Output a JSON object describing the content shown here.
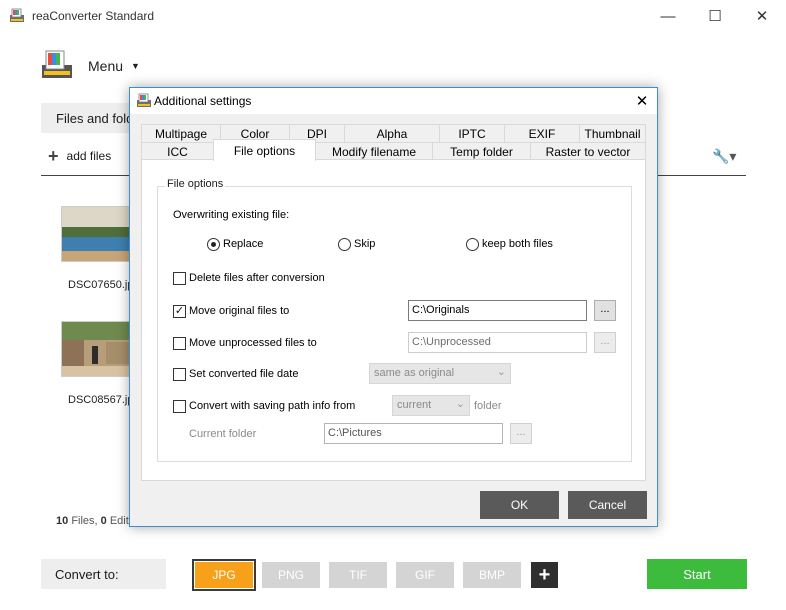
{
  "app": {
    "title": "reaConverter Standard",
    "controls": {
      "minimize": "—",
      "maximize": "☐",
      "close": "✕"
    },
    "menu_label": "Menu",
    "files_tab_label": "Files and folders",
    "add_files_label": "add files",
    "thumbnails": [
      {
        "name": "DSC07650.jpg"
      },
      {
        "name": "DSC08567.jpg"
      }
    ],
    "status": {
      "files_count": "10",
      "files_label": "Files,",
      "edit_count": "0",
      "edit_label": "Editing actions"
    },
    "convert_to_label": "Convert to:",
    "formats": [
      "JPG",
      "PNG",
      "TIF",
      "GIF",
      "BMP"
    ],
    "selected_format": "JPG",
    "add_format_label": "+",
    "start_label": "Start"
  },
  "dialog": {
    "title": "Additional settings",
    "close_label": "✕",
    "tabs_row1": [
      "Multipage",
      "Color",
      "DPI",
      "Alpha",
      "IPTC",
      "EXIF",
      "Thumbnail"
    ],
    "tabs_row2": [
      "ICC",
      "File options",
      "Modify filename",
      "Temp folder",
      "Raster to vector"
    ],
    "selected_tab": "File options",
    "group_title": "File options",
    "overwrite_label": "Overwriting existing file:",
    "overwrite_options": [
      "Replace",
      "Skip",
      "keep both files"
    ],
    "overwrite_selected": "Replace",
    "delete_label": "Delete files after conversion",
    "delete_checked": false,
    "move_original_label": "Move original files to",
    "move_original_checked": true,
    "move_original_value": "C:\\Originals",
    "move_unprocessed_label": "Move unprocessed files to",
    "move_unprocessed_checked": false,
    "move_unprocessed_value": "C:\\Unprocessed",
    "set_date_label": "Set converted file date",
    "set_date_checked": false,
    "set_date_value": "same as original",
    "path_info_label": "Convert with saving path info from",
    "path_info_checked": false,
    "path_info_value": "current",
    "path_info_suffix": "folder",
    "current_folder_label": "Current folder",
    "current_folder_value": "C:\\Pictures",
    "browse_label": "...",
    "ok_label": "OK",
    "cancel_label": "Cancel"
  },
  "colors": {
    "accent_selected_format": "#f7a11a",
    "start_button": "#3dbb3d",
    "dialog_border": "#3b8ed0",
    "dialog_buttons": "#5a5a5a"
  }
}
